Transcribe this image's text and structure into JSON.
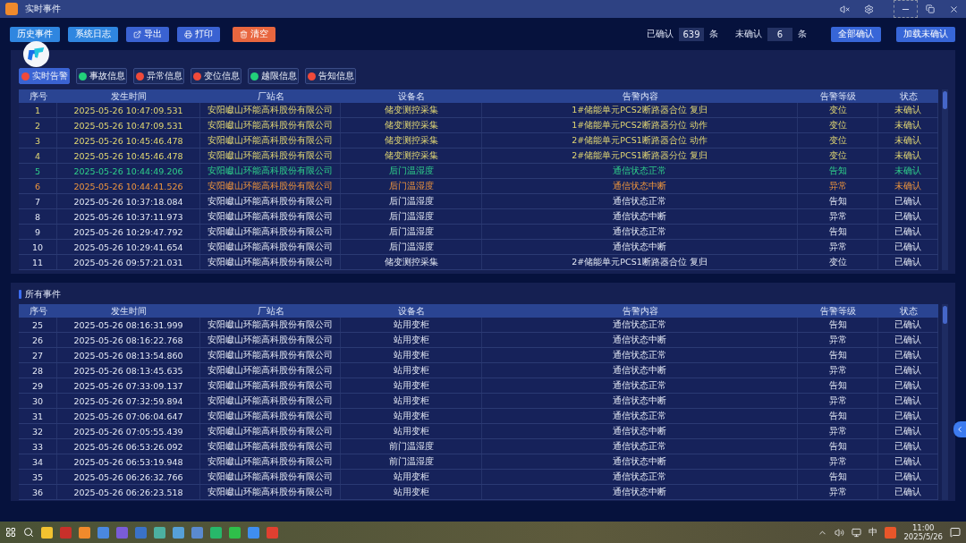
{
  "window": {
    "title": "实时事件"
  },
  "toolbar": {
    "buttons": [
      {
        "label": "历史事件",
        "kind": "plain"
      },
      {
        "label": "系统日志",
        "kind": "plain"
      },
      {
        "label": "导出",
        "kind": "export"
      },
      {
        "label": "打印",
        "kind": "print"
      },
      {
        "label": "清空",
        "kind": "clear"
      }
    ],
    "confirmed_label": "已确认",
    "confirmed_count": "639",
    "confirmed_unit": "条",
    "unconfirmed_label": "未确认",
    "unconfirmed_count": "6",
    "unconfirmed_unit": "条",
    "actions": [
      "全部确认",
      "加载未确认"
    ]
  },
  "filters": [
    {
      "label": "实时告警",
      "selected": true,
      "color": "#f04a3a"
    },
    {
      "label": "事故信息",
      "selected": false,
      "color": "#22d07a"
    },
    {
      "label": "异常信息",
      "selected": false,
      "color": "#f04a3a"
    },
    {
      "label": "变位信息",
      "selected": false,
      "color": "#f04a3a"
    },
    {
      "label": "越限信息",
      "selected": false,
      "color": "#22d07a"
    },
    {
      "label": "告知信息",
      "selected": false,
      "color": "#f04a3a"
    }
  ],
  "realtime_table": {
    "columns": [
      "序号",
      "发生时间",
      "厂站名",
      "设备名",
      "告警内容",
      "告警等级",
      "状态"
    ],
    "rows": [
      {
        "color": "#e3d873",
        "cells": [
          "1",
          "2025-05-26 10:47:09.531",
          "安阳巘山环能高科股份有限公司",
          "储变测控采集",
          "1#储能单元PCS2断路器合位 复归",
          "变位",
          "未确认"
        ]
      },
      {
        "color": "#e3d873",
        "cells": [
          "2",
          "2025-05-26 10:47:09.531",
          "安阳巘山环能高科股份有限公司",
          "储变测控采集",
          "1#储能单元PCS2断路器分位 动作",
          "变位",
          "未确认"
        ]
      },
      {
        "color": "#e3d873",
        "cells": [
          "3",
          "2025-05-26 10:45:46.478",
          "安阳巘山环能高科股份有限公司",
          "储变测控采集",
          "2#储能单元PCS1断路器合位 动作",
          "变位",
          "未确认"
        ]
      },
      {
        "color": "#e3d873",
        "cells": [
          "4",
          "2025-05-26 10:45:46.478",
          "安阳巘山环能高科股份有限公司",
          "储变测控采集",
          "2#储能单元PCS1断路器分位 复归",
          "变位",
          "未确认"
        ]
      },
      {
        "color": "#2fd08a",
        "cells": [
          "5",
          "2025-05-26 10:44:49.206",
          "安阳巘山环能高科股份有限公司",
          "后门温湿度",
          "通信状态正常",
          "告知",
          "未确认"
        ]
      },
      {
        "color": "#f0963c",
        "cells": [
          "6",
          "2025-05-26 10:44:41.526",
          "安阳巘山环能高科股份有限公司",
          "后门温湿度",
          "通信状态中断",
          "异常",
          "未确认"
        ]
      },
      {
        "color": "#e4e9f5",
        "cells": [
          "7",
          "2025-05-26 10:37:18.084",
          "安阳巘山环能高科股份有限公司",
          "后门温湿度",
          "通信状态正常",
          "告知",
          "已确认"
        ]
      },
      {
        "color": "#e4e9f5",
        "cells": [
          "8",
          "2025-05-26 10:37:11.973",
          "安阳巘山环能高科股份有限公司",
          "后门温湿度",
          "通信状态中断",
          "异常",
          "已确认"
        ]
      },
      {
        "color": "#e4e9f5",
        "cells": [
          "9",
          "2025-05-26 10:29:47.792",
          "安阳巘山环能高科股份有限公司",
          "后门温湿度",
          "通信状态正常",
          "告知",
          "已确认"
        ]
      },
      {
        "color": "#e4e9f5",
        "cells": [
          "10",
          "2025-05-26 10:29:41.654",
          "安阳巘山环能高科股份有限公司",
          "后门温湿度",
          "通信状态中断",
          "异常",
          "已确认"
        ]
      },
      {
        "color": "#e4e9f5",
        "cells": [
          "11",
          "2025-05-26 09:57:21.031",
          "安阳巘山环能高科股份有限公司",
          "储变测控采集",
          "2#储能单元PCS1断路器合位 复归",
          "变位",
          "已确认"
        ]
      }
    ]
  },
  "all_events": {
    "title": "所有事件",
    "columns": [
      "序号",
      "发生时间",
      "厂站名",
      "设备名",
      "告警内容",
      "告警等级",
      "状态"
    ],
    "rows": [
      {
        "color": "#e4e9f5",
        "cells": [
          "25",
          "2025-05-26 08:16:31.999",
          "安阳巘山环能高科股份有限公司",
          "站用变柜",
          "通信状态正常",
          "告知",
          "已确认"
        ]
      },
      {
        "color": "#e4e9f5",
        "cells": [
          "26",
          "2025-05-26 08:16:22.768",
          "安阳巘山环能高科股份有限公司",
          "站用变柜",
          "通信状态中断",
          "异常",
          "已确认"
        ]
      },
      {
        "color": "#e4e9f5",
        "cells": [
          "27",
          "2025-05-26 08:13:54.860",
          "安阳巘山环能高科股份有限公司",
          "站用变柜",
          "通信状态正常",
          "告知",
          "已确认"
        ]
      },
      {
        "color": "#e4e9f5",
        "cells": [
          "28",
          "2025-05-26 08:13:45.635",
          "安阳巘山环能高科股份有限公司",
          "站用变柜",
          "通信状态中断",
          "异常",
          "已确认"
        ]
      },
      {
        "color": "#e4e9f5",
        "cells": [
          "29",
          "2025-05-26 07:33:09.137",
          "安阳巘山环能高科股份有限公司",
          "站用变柜",
          "通信状态正常",
          "告知",
          "已确认"
        ]
      },
      {
        "color": "#e4e9f5",
        "cells": [
          "30",
          "2025-05-26 07:32:59.894",
          "安阳巘山环能高科股份有限公司",
          "站用变柜",
          "通信状态中断",
          "异常",
          "已确认"
        ]
      },
      {
        "color": "#e4e9f5",
        "cells": [
          "31",
          "2025-05-26 07:06:04.647",
          "安阳巘山环能高科股份有限公司",
          "站用变柜",
          "通信状态正常",
          "告知",
          "已确认"
        ]
      },
      {
        "color": "#e4e9f5",
        "cells": [
          "32",
          "2025-05-26 07:05:55.439",
          "安阳巘山环能高科股份有限公司",
          "站用变柜",
          "通信状态中断",
          "异常",
          "已确认"
        ]
      },
      {
        "color": "#e4e9f5",
        "cells": [
          "33",
          "2025-05-26 06:53:26.092",
          "安阳巘山环能高科股份有限公司",
          "前门温湿度",
          "通信状态正常",
          "告知",
          "已确认"
        ]
      },
      {
        "color": "#e4e9f5",
        "cells": [
          "34",
          "2025-05-26 06:53:19.948",
          "安阳巘山环能高科股份有限公司",
          "前门温湿度",
          "通信状态中断",
          "异常",
          "已确认"
        ]
      },
      {
        "color": "#e4e9f5",
        "cells": [
          "35",
          "2025-05-26 06:26:32.766",
          "安阳巘山环能高科股份有限公司",
          "站用变柜",
          "通信状态正常",
          "告知",
          "已确认"
        ]
      },
      {
        "color": "#e4e9f5",
        "cells": [
          "36",
          "2025-05-26 06:26:23.518",
          "安阳巘山环能高科股份有限公司",
          "站用变柜",
          "通信状态中断",
          "异常",
          "已确认"
        ]
      }
    ]
  },
  "taskbar": {
    "input_method": "中",
    "time": "11:00",
    "date": "2025/5/26"
  }
}
